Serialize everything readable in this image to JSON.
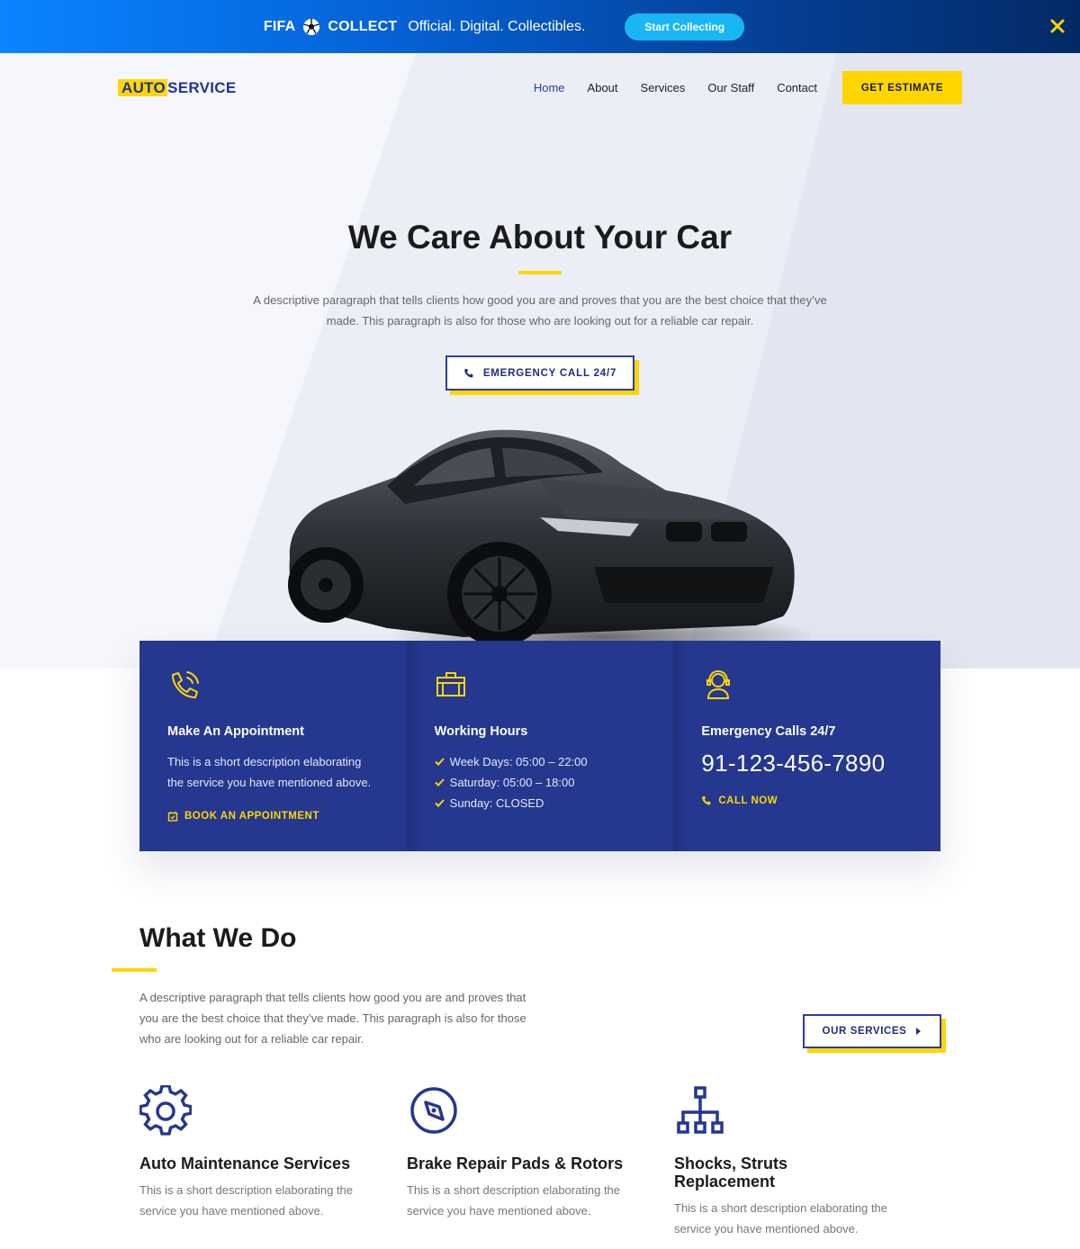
{
  "promo": {
    "brand_left": "FIFA",
    "brand_right": "COLLECT",
    "tagline": "Official. Digital. Collectibles.",
    "cta": "Start Collecting",
    "close_icon": "close-icon"
  },
  "header": {
    "logo_part1": "AUTO",
    "logo_part2": "SERVICE",
    "nav": [
      "Home",
      "About",
      "Services",
      "Our Staff",
      "Contact"
    ],
    "active_nav": "Home",
    "cta": "GET ESTIMATE"
  },
  "hero": {
    "title": "We Care About Your Car",
    "description": "A descriptive paragraph that tells clients how good you are and proves that you are the best choice that they’ve made. This paragraph is also for those who are looking out for a reliable car repair.",
    "button": "EMERGENCY CALL 24/7"
  },
  "info": {
    "appointment": {
      "icon": "phone-ringing-icon",
      "title": "Make An Appointment",
      "text": "This is a short description elaborating the service you have mentioned above.",
      "link": "BOOK AN APPOINTMENT"
    },
    "hours": {
      "icon": "briefcase-icon",
      "title": "Working Hours",
      "items": [
        "Week Days: 05:00 – 22:00",
        "Saturday: 05:00 – 18:00",
        "Sunday: CLOSED"
      ]
    },
    "emergency": {
      "icon": "headset-icon",
      "title": "Emergency Calls 24/7",
      "phone": "91-123-456-7890",
      "link": "CALL NOW"
    }
  },
  "what_we_do": {
    "title": "What We Do",
    "description": "A descriptive paragraph that tells clients how good you are and proves that you are the best choice that they’ve made. This paragraph is also for those who are looking out for a reliable car repair.",
    "button": "OUR SERVICES",
    "services": [
      {
        "icon": "gear-icon",
        "title": "Auto Maintenance Services",
        "text": "This is a short description elaborating the service you have mentioned above."
      },
      {
        "icon": "compass-icon",
        "title": "Brake Repair Pads & Rotors",
        "text": "This is a short description elaborating the service you have mentioned above."
      },
      {
        "icon": "hierarchy-icon",
        "title": "Shocks, Struts Replacement",
        "text": "This is a short description elaborating the service you have mentioned above."
      }
    ]
  },
  "colors": {
    "primary_blue": "#25378f",
    "accent_yellow": "#ffd600",
    "promo_gradient_start": "#0a84ff",
    "promo_gradient_end": "#032a66"
  }
}
